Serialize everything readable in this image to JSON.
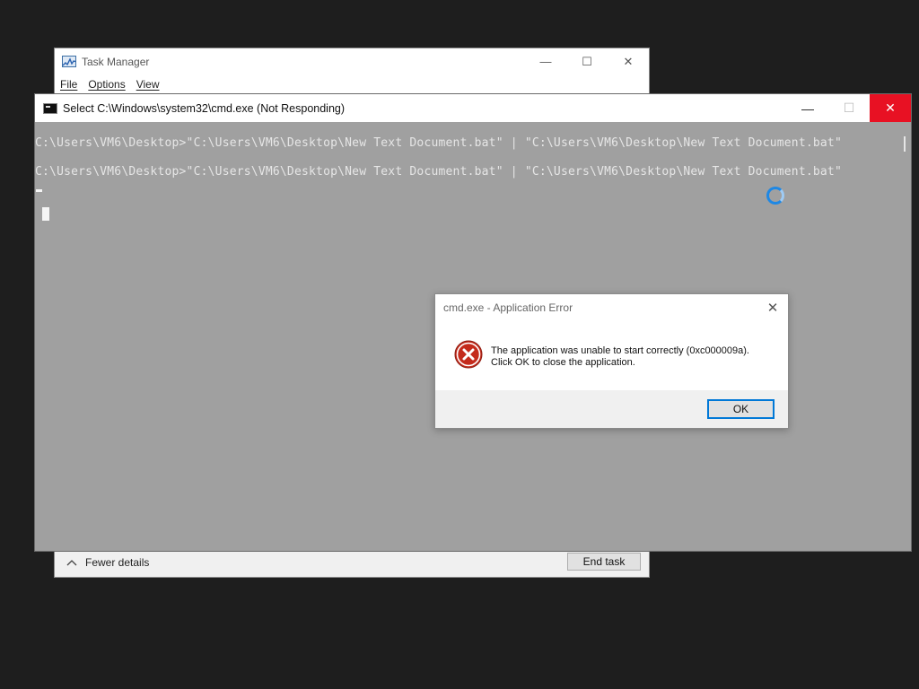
{
  "task_manager": {
    "title": "Task Manager",
    "icon": "task-manager-icon",
    "window_controls": {
      "minimize": "—",
      "maximize": "☐",
      "close": "✕"
    },
    "menu": [
      "File",
      "Options",
      "View"
    ],
    "footer": {
      "fewer_details_icon": "chevron-up-icon",
      "fewer_details_label": "Fewer details",
      "end_task_label": "End task"
    }
  },
  "cmd_window": {
    "title": "Select C:\\Windows\\system32\\cmd.exe (Not Responding)",
    "icon": "cmd-icon",
    "window_controls": {
      "minimize": "—",
      "maximize": "☐",
      "close": "✕"
    },
    "colors": {
      "close_button": "#e81123",
      "not_responding_overlay": "#a0a0a0"
    },
    "lines": [
      "C:\\Users\\VM6\\Desktop>\"C:\\Users\\VM6\\Desktop\\New Text Document.bat\" | \"C:\\Users\\VM6\\Desktop\\New Text Document.bat\"",
      "C:\\Users\\VM6\\Desktop>\"C:\\Users\\VM6\\Desktop\\New Text Document.bat\" | \"C:\\Users\\VM6\\Desktop\\New Text Document.bat\""
    ],
    "busy_cursor_icon": "loading-spinner-icon"
  },
  "error_dialog": {
    "title": "cmd.exe - Application Error",
    "close_glyph": "✕",
    "icon": "error-icon",
    "message_line1": "The application was unable to start correctly (0xc000009a).",
    "message_line2": "Click OK to close the application.",
    "ok_label": "OK",
    "colors": {
      "error_red": "#c42b1c",
      "accent": "#0078d7"
    }
  }
}
